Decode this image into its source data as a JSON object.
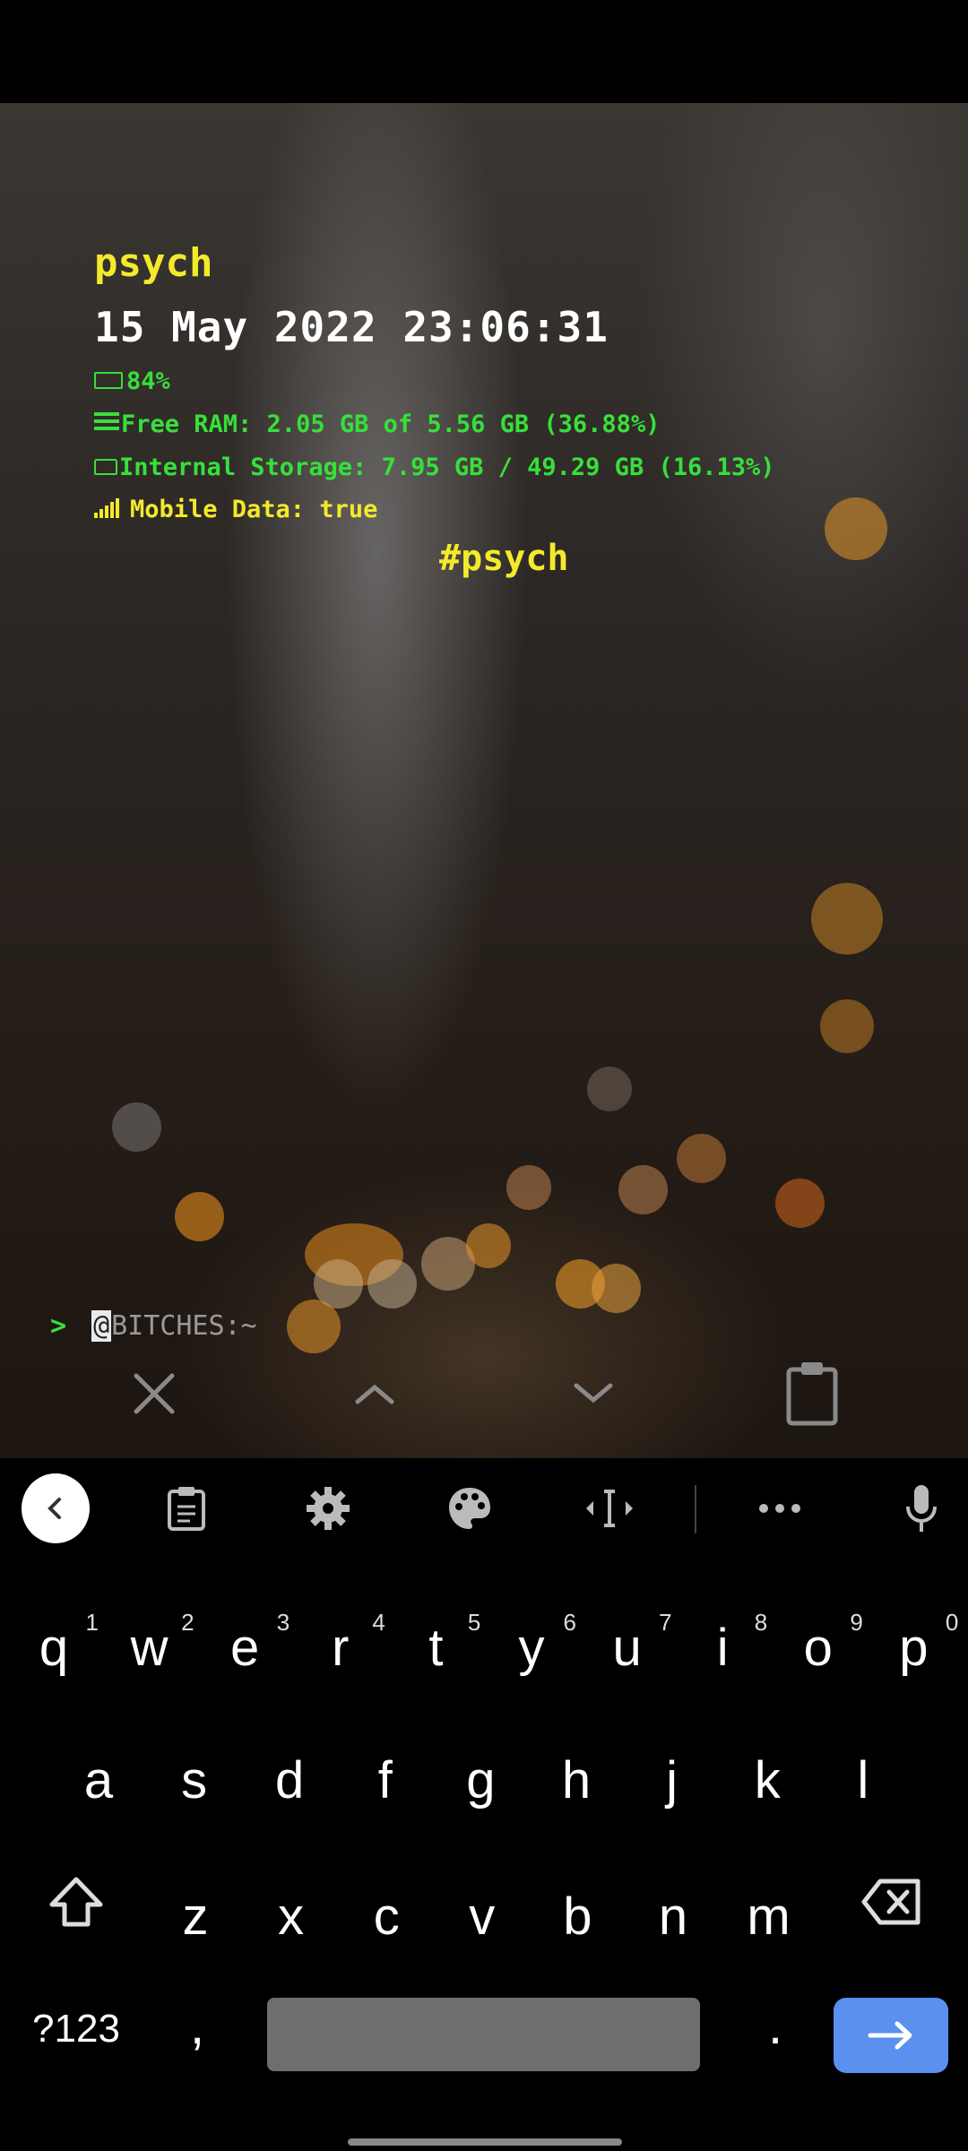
{
  "hud": {
    "username": "psych",
    "datetime": "15 May 2022 23:06:31",
    "battery": "84%",
    "ram": "Free RAM: 2.05 GB of 5.56 GB (36.88%)",
    "storage": "Internal Storage: 7.95 GB / 49.29 GB (16.13%)",
    "mobile_data": "Mobile Data: true",
    "hashtag": "#psych"
  },
  "prompt": {
    "caret": ">",
    "cursor_char": "@",
    "text": "BITCHES:~"
  },
  "tools": [
    {
      "name": "close-icon"
    },
    {
      "name": "chevron-up-icon"
    },
    {
      "name": "chevron-down-icon"
    },
    {
      "name": "clipboard-icon"
    }
  ],
  "keyboard": {
    "toolbar": [
      "back-icon",
      "clipboard-icon",
      "gear-icon",
      "palette-icon",
      "text-cursor-icon",
      "more-icon",
      "microphone-icon"
    ],
    "row1": [
      {
        "label": "q",
        "hint": "1"
      },
      {
        "label": "w",
        "hint": "2"
      },
      {
        "label": "e",
        "hint": "3"
      },
      {
        "label": "r",
        "hint": "4"
      },
      {
        "label": "t",
        "hint": "5"
      },
      {
        "label": "y",
        "hint": "6"
      },
      {
        "label": "u",
        "hint": "7"
      },
      {
        "label": "i",
        "hint": "8"
      },
      {
        "label": "o",
        "hint": "9"
      },
      {
        "label": "p",
        "hint": "0"
      }
    ],
    "row2": [
      "a",
      "s",
      "d",
      "f",
      "g",
      "h",
      "j",
      "k",
      "l"
    ],
    "row3": [
      "z",
      "x",
      "c",
      "v",
      "b",
      "n",
      "m"
    ],
    "symbols_key": "?123",
    "comma_key": ",",
    "period_key": ".",
    "accent_color": "#5b8ff0"
  },
  "colors": {
    "green": "#37e03a",
    "yellow": "#f3ea2b"
  }
}
